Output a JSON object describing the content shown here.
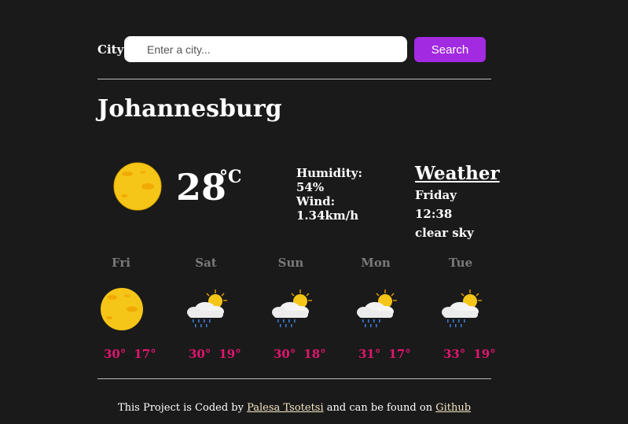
{
  "search": {
    "label": "City",
    "placeholder": "Enter a city...",
    "button_label": "Search"
  },
  "current": {
    "city": "Johannesburg",
    "temperature": "28",
    "unit": "°C",
    "humidity_label": "Humidity:",
    "humidity_value": "54%",
    "wind_label": "Wind:",
    "wind_value": "1.34km/h",
    "heading": "Weather",
    "time": "Friday 12:38",
    "description": "clear sky",
    "icon": "sun-icon"
  },
  "forecast": [
    {
      "day": "Fri",
      "max": "30°",
      "min": "17°",
      "icon": "sun-icon"
    },
    {
      "day": "Sat",
      "max": "30°",
      "min": "19°",
      "icon": "sun-cloud-rain-icon"
    },
    {
      "day": "Sun",
      "max": "30°",
      "min": "18°",
      "icon": "sun-cloud-rain-icon"
    },
    {
      "day": "Mon",
      "max": "31°",
      "min": "17°",
      "icon": "sun-cloud-rain-icon"
    },
    {
      "day": "Tue",
      "max": "33°",
      "min": "19°",
      "icon": "sun-cloud-rain-icon"
    }
  ],
  "footer": {
    "prefix": "This Project is Coded by",
    "author_link": "Palesa Tsotetsi",
    "middle": "and can be found on",
    "repo_link": "Github"
  },
  "colors": {
    "background": "#1a1a1a",
    "accent_button": "#a22ae0",
    "forecast_temp": "#e0166e",
    "forecast_day": "#7a7a7a",
    "link": "#f5e7c3"
  }
}
